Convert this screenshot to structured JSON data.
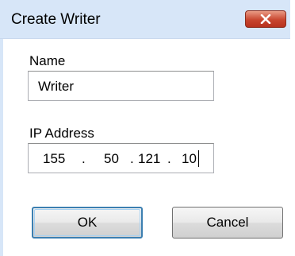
{
  "dialog": {
    "title": "Create Writer",
    "close_icon": "close-x-icon"
  },
  "name_field": {
    "label": "Name",
    "value": "Writer"
  },
  "ip_field": {
    "label": "IP Address",
    "octet1": "155",
    "octet2": "50",
    "octet3": "121",
    "octet4": "10",
    "dot1": ".",
    "dot2": ".",
    "dot3": "."
  },
  "buttons": {
    "ok": "OK",
    "cancel": "Cancel"
  },
  "colors": {
    "titlebar": "#d7e6f8",
    "close_button": "#c8462f",
    "ok_border": "#3c7fb1"
  }
}
